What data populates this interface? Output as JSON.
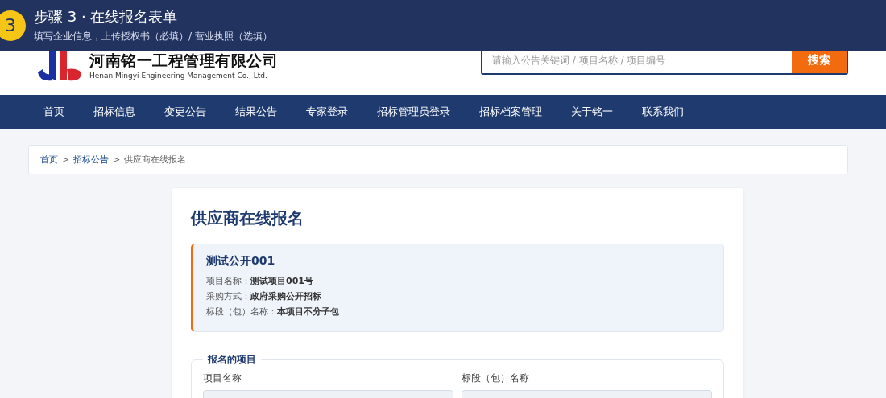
{
  "step_banner": {
    "number": "3",
    "title": "步骤 3 · 在线报名表单",
    "subtitle": "填写企业信息，上传授权书（必填）/ 营业执照（选填）"
  },
  "header": {
    "company_name": "河南铭一工程管理有限公司",
    "company_name_en": "Henan Mingyi Engineering Management Co., Ltd.",
    "search": {
      "placeholder": "请输入公告关键词 / 项目名称 / 项目编号",
      "button": "搜索"
    }
  },
  "nav": [
    {
      "label": "首页"
    },
    {
      "label": "招标信息"
    },
    {
      "label": "变更公告"
    },
    {
      "label": "结果公告"
    },
    {
      "label": "专家登录"
    },
    {
      "label": "招标管理员登录"
    },
    {
      "label": "招标档案管理"
    },
    {
      "label": "关于铭一"
    },
    {
      "label": "联系我们"
    }
  ],
  "breadcrumb_separator": ">",
  "breadcrumb": [
    {
      "label": "首页",
      "kind": "link"
    },
    {
      "label": "招标公告",
      "kind": "link"
    },
    {
      "label": "供应商在线报名",
      "kind": "current"
    }
  ],
  "page_title": "供应商在线报名",
  "project_card": {
    "title": "测试公开001",
    "fields": [
      {
        "label": "项目名称：",
        "value": "测试项目001号"
      },
      {
        "label": "采购方式：",
        "value": "政府采购公开招标"
      },
      {
        "label": "标段（包）名称：",
        "value": "本项目不分子包"
      }
    ]
  },
  "form_section": {
    "legend": "报名的项目",
    "fields": [
      {
        "label": "项目名称"
      },
      {
        "label": "标段（包）名称"
      }
    ]
  }
}
